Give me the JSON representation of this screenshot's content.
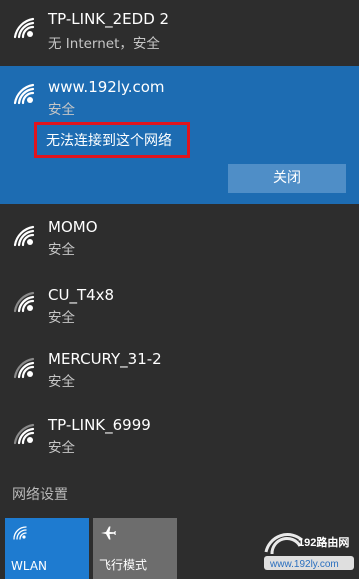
{
  "networks": [
    {
      "name": "TP-LINK_2EDD 2",
      "status": "无 Internet，安全"
    },
    {
      "name": "www.192ly.com",
      "status": "安全"
    },
    {
      "name": "MOMO",
      "status": "安全"
    },
    {
      "name": "CU_T4x8",
      "status": "安全"
    },
    {
      "name": "MERCURY_31-2",
      "status": "安全"
    },
    {
      "name": "TP-LINK_6999",
      "status": "安全"
    }
  ],
  "selected": {
    "error_message": "无法连接到这个网络",
    "close_label": "关闭"
  },
  "settings_link": "网络设置",
  "quick_actions": {
    "wlan_label": "WLAN",
    "airplane_label": "飞行模式"
  },
  "watermark": {
    "brand": "192路由网",
    "site": "www.192ly.com"
  },
  "colors": {
    "background": "#2d2d2d",
    "selected": "#1d6cb2",
    "error_border": "#e0141e",
    "close_button": "#4f8ec7",
    "wlan_tile": "#1e7bd0",
    "airplane_tile": "#6d6d6d"
  },
  "icons": {
    "network": "wifi-signal-icon",
    "wlan": "wifi-icon",
    "airplane": "airplane-icon"
  }
}
